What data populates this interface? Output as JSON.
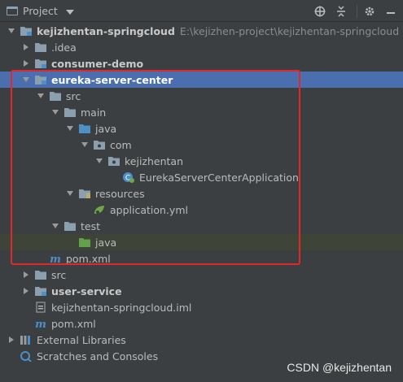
{
  "toolbar": {
    "title": "Project",
    "icons": [
      "globe-icon",
      "collapse-icon",
      "gear-icon",
      "minimize-icon"
    ]
  },
  "colors": {
    "selection": "#4b6eaf",
    "highlight_row": "#3f4438",
    "red_box": "#e0282d",
    "folder": "#8c9fae",
    "source_folder": "#4d8fc7",
    "test_folder": "#62a049",
    "background": "#3c3f41"
  },
  "tree": [
    {
      "label": "kejizhentan-springcloud",
      "path": "E:\\kejizhen-project\\kejizhentan-springcloud",
      "icon": "module-folder-icon",
      "expanded": true,
      "bold": true
    },
    {
      "label": ".idea",
      "icon": "folder-icon",
      "expanded": false
    },
    {
      "label": "consumer-demo",
      "icon": "module-folder-icon",
      "expanded": false,
      "bold": true
    },
    {
      "label": "eureka-server-center",
      "icon": "module-folder-icon",
      "expanded": true,
      "bold": true,
      "selected": true
    },
    {
      "label": "src",
      "icon": "folder-icon",
      "expanded": true
    },
    {
      "label": "main",
      "icon": "folder-icon",
      "expanded": true
    },
    {
      "label": "java",
      "icon": "source-folder-icon",
      "expanded": true
    },
    {
      "label": "com",
      "icon": "package-icon",
      "expanded": true
    },
    {
      "label": "kejizhentan",
      "icon": "package-icon",
      "expanded": true
    },
    {
      "label": "EurekaServerCenterApplication",
      "icon": "spring-class-icon"
    },
    {
      "label": "resources",
      "icon": "resources-folder-icon",
      "expanded": true
    },
    {
      "label": "application.yml",
      "icon": "spring-yml-icon"
    },
    {
      "label": "test",
      "icon": "folder-icon",
      "expanded": true
    },
    {
      "label": "java",
      "icon": "test-folder-icon",
      "highlight": true
    },
    {
      "label": "pom.xml",
      "icon": "maven-icon"
    },
    {
      "label": "src",
      "icon": "folder-icon",
      "expanded": false
    },
    {
      "label": "user-service",
      "icon": "module-folder-icon",
      "expanded": false,
      "bold": true
    },
    {
      "label": "kejizhentan-springcloud.iml",
      "icon": "iml-file-icon"
    },
    {
      "label": "pom.xml",
      "icon": "maven-icon"
    },
    {
      "label": "External Libraries",
      "icon": "libraries-icon",
      "expanded": false
    },
    {
      "label": "Scratches and Consoles",
      "icon": "scratches-icon"
    }
  ],
  "watermark": "CSDN @kejizhentan"
}
